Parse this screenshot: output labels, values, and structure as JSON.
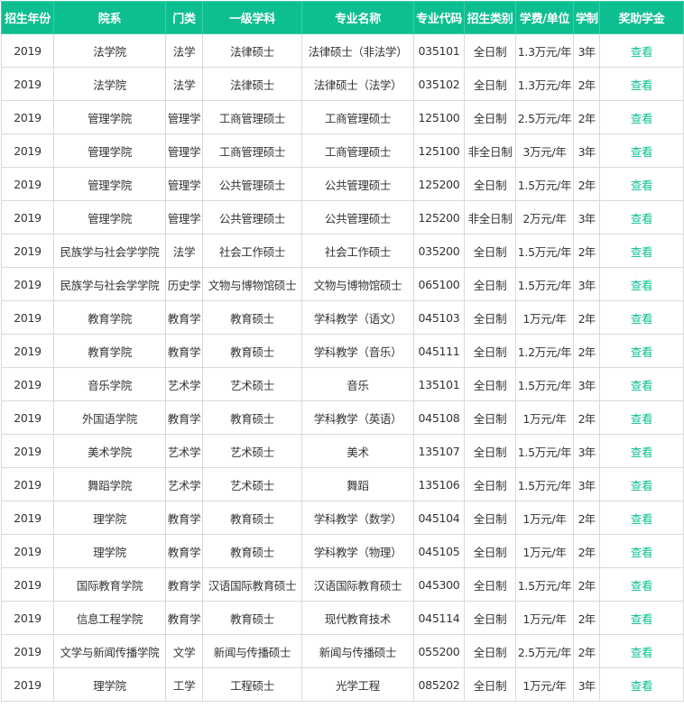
{
  "table": {
    "headers": [
      "招生年份",
      "院系",
      "门类",
      "一级学科",
      "专业名称",
      "专业代码",
      "招生类别",
      "学费/单位",
      "学制",
      "奖助学金"
    ],
    "rows": [
      [
        "2019",
        "法学院",
        "法学",
        "法律硕士",
        "法律硕士（非法学）",
        "035101",
        "全日制",
        "1.3万元/年",
        "3年",
        "查看"
      ],
      [
        "2019",
        "法学院",
        "法学",
        "法律硕士",
        "法律硕士（法学）",
        "035102",
        "全日制",
        "1.3万元/年",
        "2年",
        "查看"
      ],
      [
        "2019",
        "管理学院",
        "管理学",
        "工商管理硕士",
        "工商管理硕士",
        "125100",
        "全日制",
        "2.5万元/年",
        "2年",
        "查看"
      ],
      [
        "2019",
        "管理学院",
        "管理学",
        "工商管理硕士",
        "工商管理硕士",
        "125100",
        "非全日制",
        "3万元/年",
        "3年",
        "查看"
      ],
      [
        "2019",
        "管理学院",
        "管理学",
        "公共管理硕士",
        "公共管理硕士",
        "125200",
        "全日制",
        "1.5万元/年",
        "2年",
        "查看"
      ],
      [
        "2019",
        "管理学院",
        "管理学",
        "公共管理硕士",
        "公共管理硕士",
        "125200",
        "非全日制",
        "2万元/年",
        "3年",
        "查看"
      ],
      [
        "2019",
        "民族学与社会学学院",
        "法学",
        "社会工作硕士",
        "社会工作硕士",
        "035200",
        "全日制",
        "1.5万元/年",
        "2年",
        "查看"
      ],
      [
        "2019",
        "民族学与社会学学院",
        "历史学",
        "文物与博物馆硕士",
        "文物与博物馆硕士",
        "065100",
        "全日制",
        "1.5万元/年",
        "3年",
        "查看"
      ],
      [
        "2019",
        "教育学院",
        "教育学",
        "教育硕士",
        "学科教学（语文）",
        "045103",
        "全日制",
        "1万元/年",
        "2年",
        "查看"
      ],
      [
        "2019",
        "教育学院",
        "教育学",
        "教育硕士",
        "学科教学（音乐）",
        "045111",
        "全日制",
        "1.2万元/年",
        "2年",
        "查看"
      ],
      [
        "2019",
        "音乐学院",
        "艺术学",
        "艺术硕士",
        "音乐",
        "135101",
        "全日制",
        "1.5万元/年",
        "3年",
        "查看"
      ],
      [
        "2019",
        "外国语学院",
        "教育学",
        "教育硕士",
        "学科教学（英语）",
        "045108",
        "全日制",
        "1万元/年",
        "2年",
        "查看"
      ],
      [
        "2019",
        "美术学院",
        "艺术学",
        "艺术硕士",
        "美术",
        "135107",
        "全日制",
        "1.5万元/年",
        "3年",
        "查看"
      ],
      [
        "2019",
        "舞蹈学院",
        "艺术学",
        "艺术硕士",
        "舞蹈",
        "135106",
        "全日制",
        "1.5万元/年",
        "3年",
        "查看"
      ],
      [
        "2019",
        "理学院",
        "教育学",
        "教育硕士",
        "学科教学（数学）",
        "045104",
        "全日制",
        "1万元/年",
        "2年",
        "查看"
      ],
      [
        "2019",
        "理学院",
        "教育学",
        "教育硕士",
        "学科教学（物理）",
        "045105",
        "全日制",
        "1万元/年",
        "2年",
        "查看"
      ],
      [
        "2019",
        "国际教育学院",
        "教育学",
        "汉语国际教育硕士",
        "汉语国际教育硕士",
        "045300",
        "全日制",
        "1.5万元/年",
        "2年",
        "查看"
      ],
      [
        "2019",
        "信息工程学院",
        "教育学",
        "教育硕士",
        "现代教育技术",
        "045114",
        "全日制",
        "1万元/年",
        "2年",
        "查看"
      ],
      [
        "2019",
        "文学与新闻传播学院",
        "文学",
        "新闻与传播硕士",
        "新闻与传播硕士",
        "055200",
        "全日制",
        "2.5万元/年",
        "2年",
        "查看"
      ],
      [
        "2019",
        "理学院",
        "工学",
        "工程硕士",
        "光学工程",
        "085202",
        "全日制",
        "1万元/年",
        "3年",
        "查看"
      ]
    ]
  }
}
